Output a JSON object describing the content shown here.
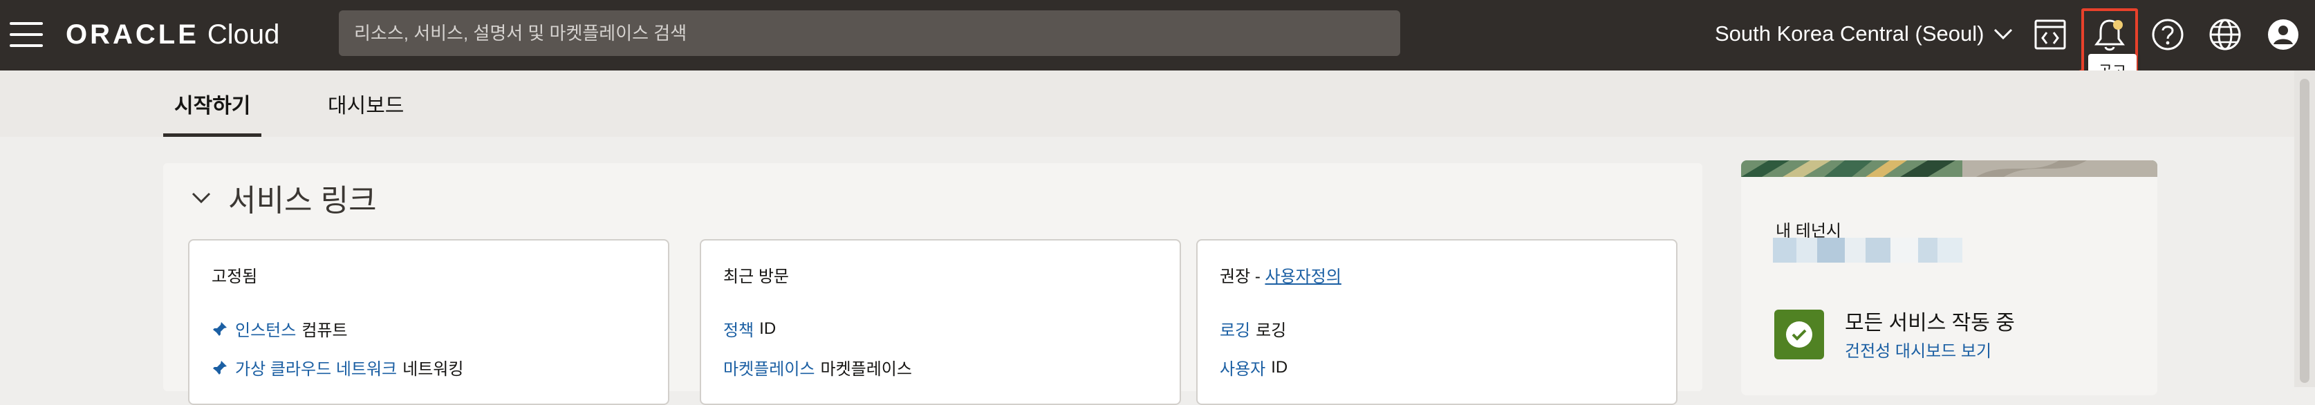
{
  "header": {
    "logo_word": "ORACLE",
    "logo_product": "Cloud",
    "search_placeholder": "리소스, 서비스, 설명서 및 마켓플레이스 검색",
    "region": "South Korea Central (Seoul)",
    "announcement_tooltip": "공고",
    "icons": [
      "menu-icon",
      "chevron-down-icon",
      "code-editor-icon",
      "bell-icon",
      "help-icon",
      "globe-icon",
      "user-profile-icon"
    ],
    "accent": "#e8412b",
    "bar_color": "#312d2a"
  },
  "tabs": [
    {
      "label": "시작하기",
      "active": true
    },
    {
      "label": "대시보드",
      "active": false
    }
  ],
  "service_links": {
    "title": "서비스 링크",
    "cards": [
      {
        "title": "고정됨",
        "items": [
          {
            "link": "인스턴스",
            "category": "컴퓨트",
            "pinned": true
          },
          {
            "link": "가상 클라우드 네트워크",
            "category": "네트워킹",
            "pinned": true
          }
        ]
      },
      {
        "title": "최근 방문",
        "items": [
          {
            "link": "정책",
            "category": "ID",
            "pinned": false
          },
          {
            "link": "마켓플레이스",
            "category": "마켓플레이스",
            "pinned": false
          }
        ]
      },
      {
        "title_prefix": "권장 - ",
        "title_link": "사용자정의",
        "items": [
          {
            "link": "로깅",
            "category": "로깅",
            "pinned": false
          },
          {
            "link": "사용자",
            "category": "ID",
            "pinned": false
          }
        ]
      }
    ]
  },
  "tenancy": {
    "label": "내 테넌시",
    "status_title": "모든 서비스 작동 중",
    "status_link": "건전성 대시보드 보기",
    "status_color": "#508223"
  }
}
